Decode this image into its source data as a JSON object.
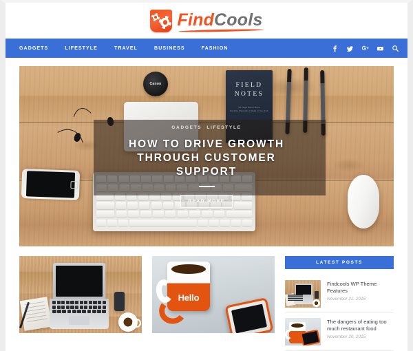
{
  "site": {
    "logo_primary": "Find",
    "logo_secondary": "Cools",
    "brand_orange": "#f4511e",
    "brand_blue": "#3b6fd8"
  },
  "nav": {
    "items": [
      {
        "label": "GADGETS"
      },
      {
        "label": "LIFESTYLE"
      },
      {
        "label": "TRAVEL"
      },
      {
        "label": "BUSINESS"
      },
      {
        "label": "FASHION"
      }
    ],
    "social": [
      {
        "name": "facebook-icon",
        "glyph": "f"
      },
      {
        "name": "twitter-icon",
        "glyph": "t"
      },
      {
        "name": "google-plus-icon",
        "glyph": "g+"
      },
      {
        "name": "youtube-icon",
        "glyph": "yt"
      },
      {
        "name": "search-icon",
        "glyph": "q"
      }
    ]
  },
  "hero": {
    "category_1": "GADGETS",
    "category_2": "LIFESTYLE",
    "title": "HOW TO DRIVE GROWTH THROUGH CUSTOMER SUPPORT",
    "read_more": "READ MORE",
    "image_alt": "Wooden desk with Apple keyboard, mouse, iPhone, earbuds, Canon lens cap and Field Notes notebook",
    "notebook_title": "FIELD NOTES",
    "notebook_subtitle": "48 Page Memo Book\nDurable Materials | Made in the USA",
    "lenscap_brand": "Canon"
  },
  "cards": [
    {
      "alt": "Laptop on wooden desk with notebook, pen, phone and coffee"
    },
    {
      "alt": "Orange Hello mug with coffee next to a white phone in an orange case"
    }
  ],
  "sidebar": {
    "widget_title": "LATEST POSTS",
    "posts": [
      {
        "title": "Findcools WP Theme Features",
        "date": "November 21, 2015"
      },
      {
        "title": "The dangers of eating too much restaurant food",
        "date": "November 20, 2015"
      }
    ]
  }
}
